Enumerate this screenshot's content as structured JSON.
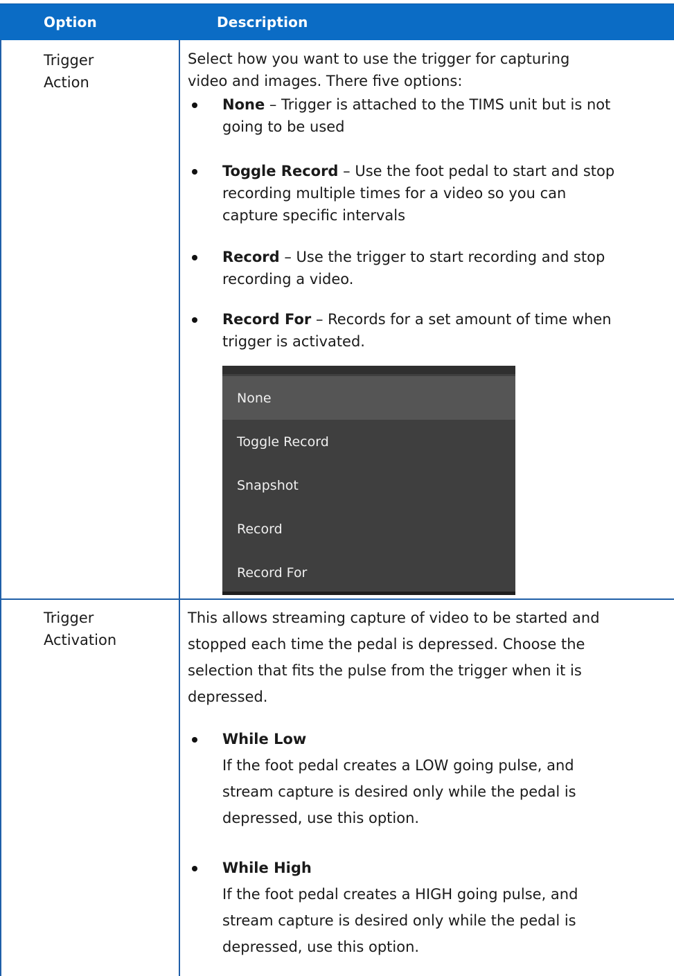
{
  "header": {
    "option": "Option",
    "description": "Description"
  },
  "rows": [
    {
      "option": [
        "Trigger",
        "Action"
      ],
      "intro": [
        "Select how you want to use the trigger for capturing",
        "video and images. There five options:"
      ],
      "bullets": [
        {
          "term": "None",
          "text": " – Trigger is attached to the TIMS unit but is not",
          "cont": [
            "going to be used"
          ]
        },
        {
          "term": "Toggle Record",
          "text": " – Use the foot pedal to start and stop",
          "cont": [
            "recording multiple times for a video so you can",
            "capture specific intervals"
          ]
        },
        {
          "term": "Record",
          "text": " – Use the trigger to start recording and stop",
          "cont": [
            "recording a video."
          ]
        },
        {
          "term": "Record For",
          "text": " – Records for a set amount of time when",
          "cont": [
            "trigger is activated."
          ]
        }
      ],
      "menu": {
        "items": [
          "None",
          "Toggle Record",
          "Snapshot",
          "Record",
          "Record For"
        ],
        "selected": "None"
      }
    },
    {
      "option": [
        "Trigger",
        "Activation"
      ],
      "intro": [
        "This allows streaming capture of video to be started and",
        "stopped each time the pedal is depressed. Choose the",
        "selection that fits the pulse from the trigger when it is",
        "depressed."
      ],
      "bullets": [
        {
          "term": "While Low",
          "cont": [
            "If the foot pedal creates a LOW going pulse, and",
            "stream capture is desired only while the pedal is",
            "depressed, use this option."
          ]
        },
        {
          "term": "While High",
          "cont": [
            "If the foot pedal creates a HIGH going pulse, and",
            "stream capture is desired only while the pedal is",
            "depressed, use this option."
          ]
        }
      ]
    }
  ],
  "colors": {
    "header_bg": "#0b6cc5",
    "border": "#1f5fa8",
    "menu_bg": "#3f3f3f",
    "menu_selected": "#555555"
  }
}
